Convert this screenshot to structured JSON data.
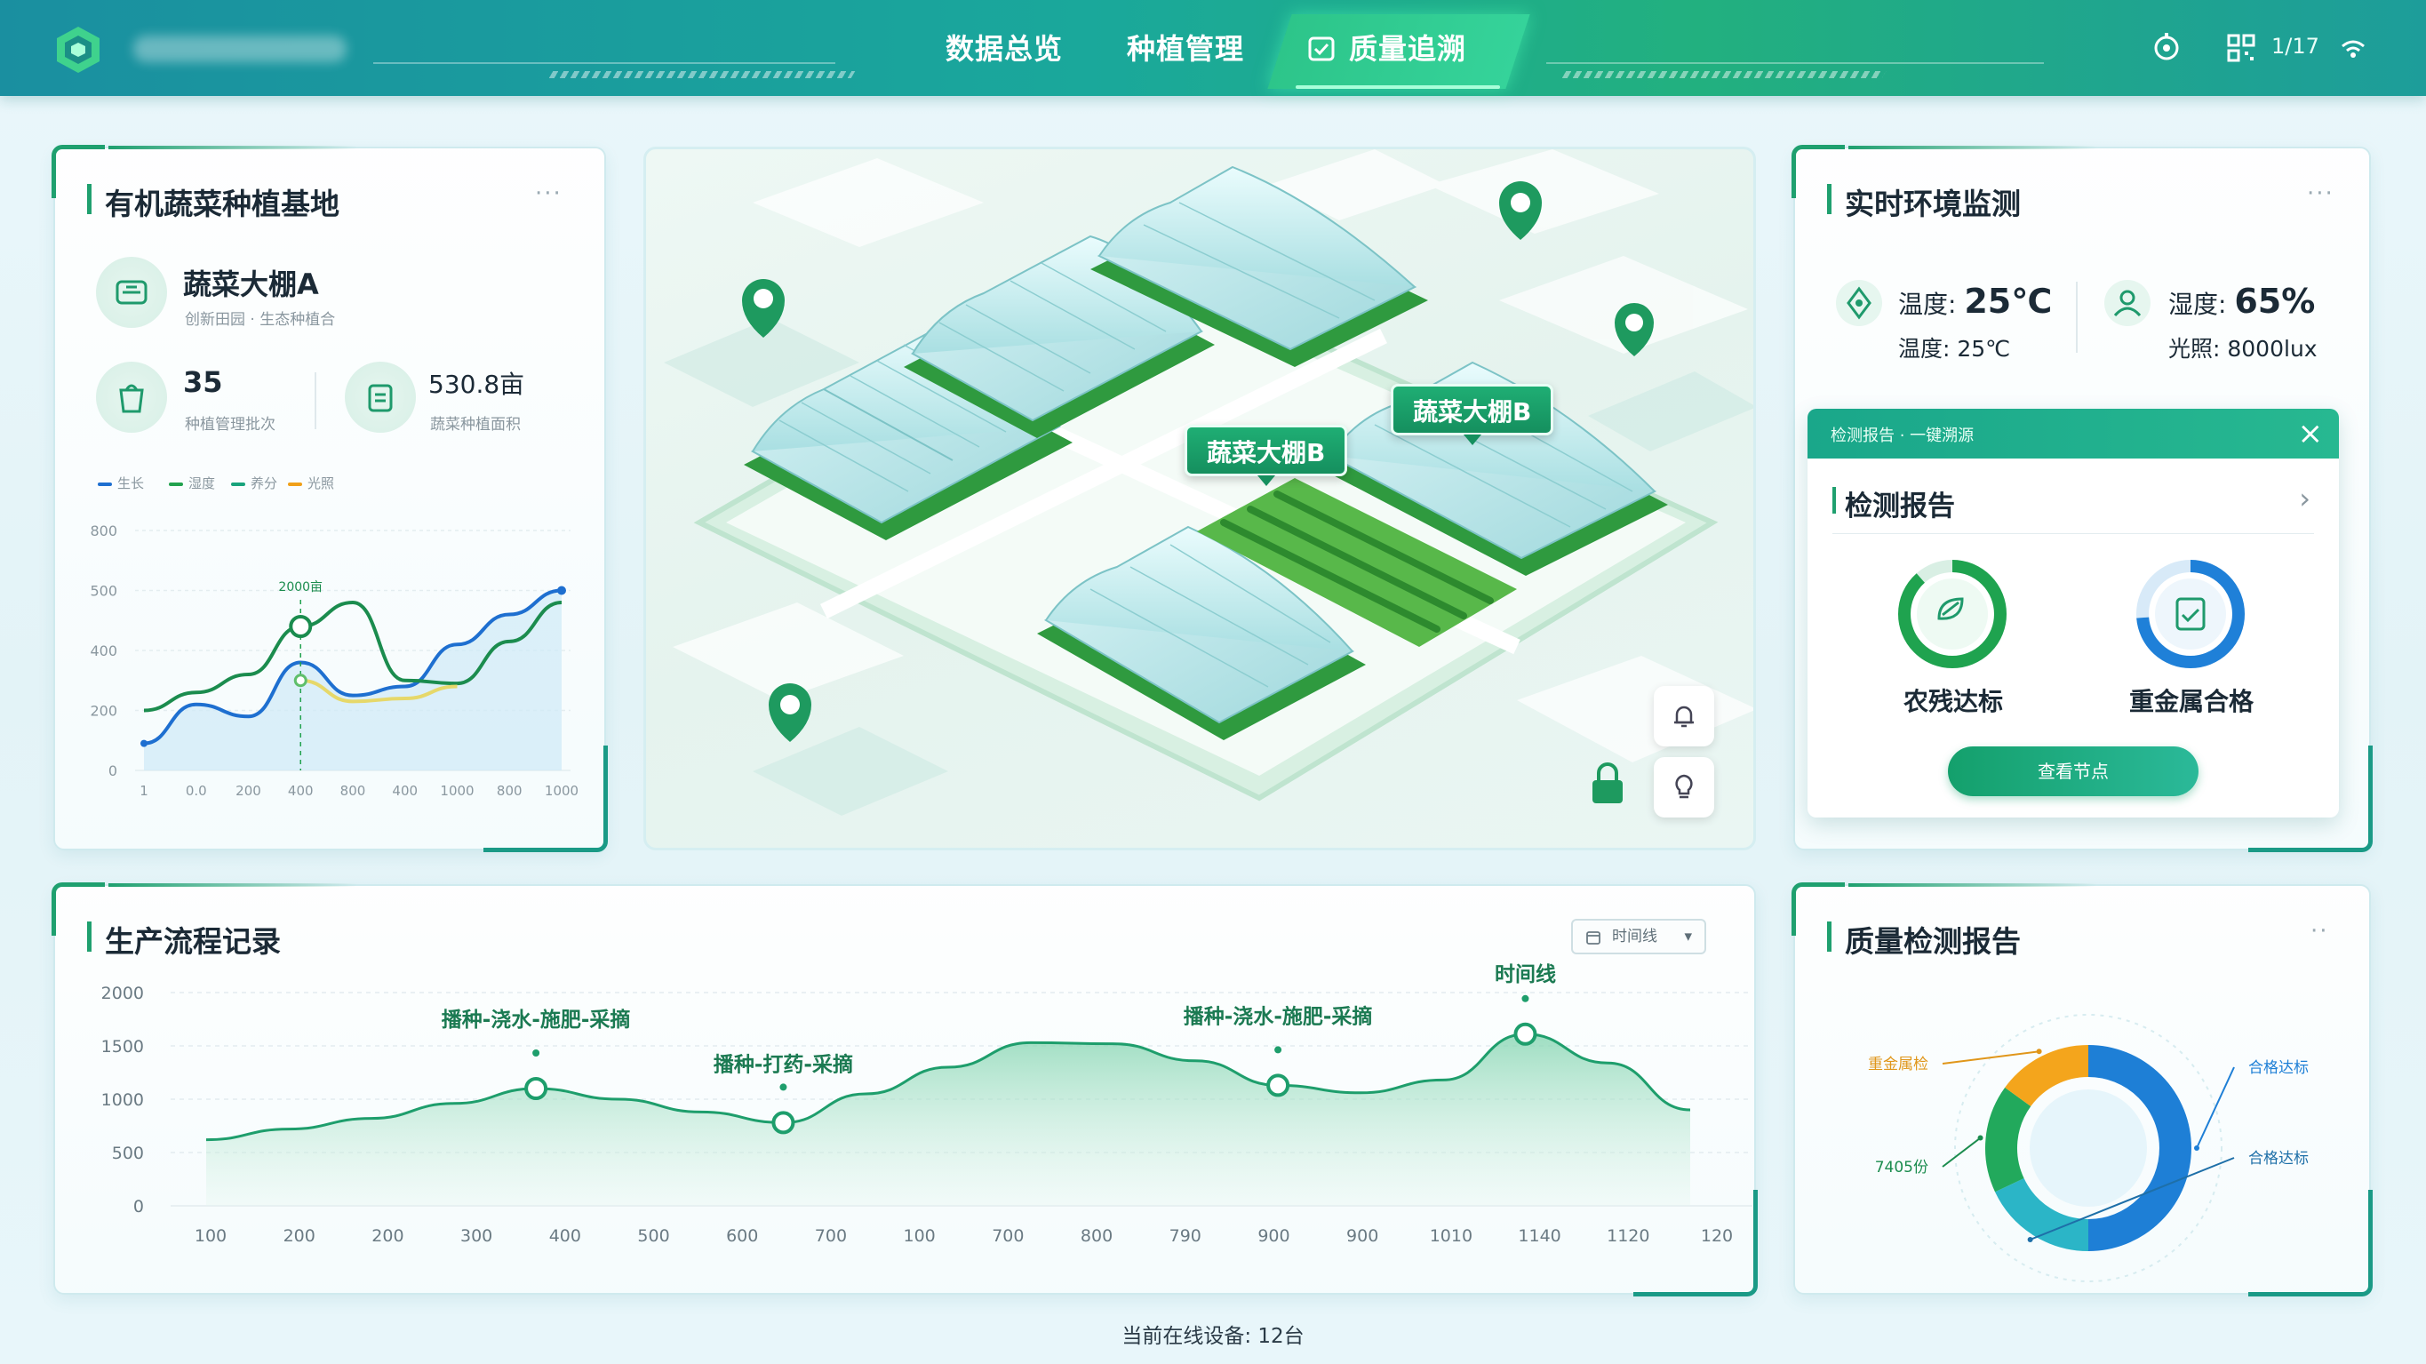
{
  "header": {
    "nav": [
      "数据总览",
      "种植管理",
      "质量追溯"
    ],
    "active_index": 2,
    "page_indicator": "1/17"
  },
  "base_panel": {
    "title": "有机蔬菜种植基地",
    "more": "···",
    "greenhouse_name": "蔬菜大棚A",
    "greenhouse_desc": "创新田园 · 生态种植合",
    "stat1_value": "35",
    "stat1_label": "种植管理批次",
    "stat2_value": "530.8亩",
    "stat2_label": "蔬菜种植面积",
    "legend": [
      {
        "name": "生长",
        "color": "#1e6fd0"
      },
      {
        "name": "湿度",
        "color": "#22a24e"
      },
      {
        "name": "养分",
        "color": "#18a37c"
      },
      {
        "name": "光照",
        "color": "#f0a019"
      }
    ],
    "peak_label": "2000亩"
  },
  "base_chart": {
    "type": "line",
    "x": [
      0,
      100,
      200,
      400,
      600,
      800,
      1000,
      1200,
      1400
    ],
    "x_tick_labels": [
      "1",
      "0.0",
      "200",
      "400",
      "800",
      "400",
      "1000",
      "800",
      "1000"
    ],
    "y_ticks": [
      0,
      200,
      400,
      600,
      800
    ],
    "y_tick_labels": [
      "0",
      "200",
      "400",
      "500",
      "800"
    ],
    "ylim": [
      0,
      800
    ],
    "series": [
      {
        "color": "#1e6fd0",
        "values": [
          90,
          220,
          180,
          360,
          250,
          280,
          420,
          520,
          600
        ]
      },
      {
        "color": "#1b8c4e",
        "values": [
          200,
          260,
          320,
          480,
          560,
          300,
          290,
          430,
          560
        ]
      },
      {
        "color": "#e6d86a",
        "values": [
          null,
          null,
          null,
          300,
          230,
          240,
          280,
          null,
          null
        ]
      }
    ]
  },
  "map": {
    "labels": [
      "蔬菜大棚B",
      "蔬菜大棚B"
    ]
  },
  "env_panel": {
    "title": "实时环境监测",
    "more": "···",
    "temp_label": "温度:",
    "temp_value": "25℃",
    "temp_sub": "温度: 25℃",
    "humidity_label": "湿度:",
    "humidity_value": "65%",
    "light_sub": "光照: 8000lux"
  },
  "report_card": {
    "head_text": "检测报告 · 一键溯源",
    "title": "检测报告",
    "ring1_label": "农残达标",
    "ring2_label": "重金属合格",
    "button_label": "查看节点"
  },
  "production_panel": {
    "title": "生产流程记录",
    "time_select": "时间线",
    "annotations": [
      "播种-浇水-施肥-采摘",
      "播种-打药-采摘",
      "播种-浇水-施肥-采摘",
      "时间线"
    ]
  },
  "production_chart": {
    "type": "area",
    "color": "#1e9e6c",
    "x_tick_labels": [
      "100",
      "200",
      "200",
      "300",
      "400",
      "500",
      "600",
      "700",
      "100",
      "700",
      "800",
      "790",
      "900",
      "900",
      "1010",
      "1140",
      "1120",
      "120"
    ],
    "y_tick_labels": [
      "0",
      "500",
      "1000",
      "1500",
      "2000"
    ],
    "ylim": [
      0,
      2000
    ],
    "values": [
      620,
      720,
      820,
      960,
      1100,
      1000,
      880,
      780,
      1050,
      1300,
      1530,
      1520,
      1360,
      1130,
      1060,
      1180,
      1610,
      1340,
      900
    ],
    "markers": [
      4,
      7,
      13,
      16
    ]
  },
  "quality_panel": {
    "title": "质量检测报告",
    "more": "··",
    "labels": [
      "合格达标",
      "合格达标",
      "7405份",
      "重金属检"
    ]
  },
  "quality_chart": {
    "type": "pie",
    "slices": [
      {
        "name": "合格达标",
        "value": 0.5,
        "color": "#1e7fd6"
      },
      {
        "name": "重金属检",
        "value": 0.18,
        "color": "#2bb5c7"
      },
      {
        "name": "7405份",
        "value": 0.17,
        "color": "#22a95c"
      },
      {
        "name": "合格达标",
        "value": 0.15,
        "color": "#f4a51c"
      }
    ]
  },
  "footer": {
    "status": "当前在线设备: 12台"
  }
}
